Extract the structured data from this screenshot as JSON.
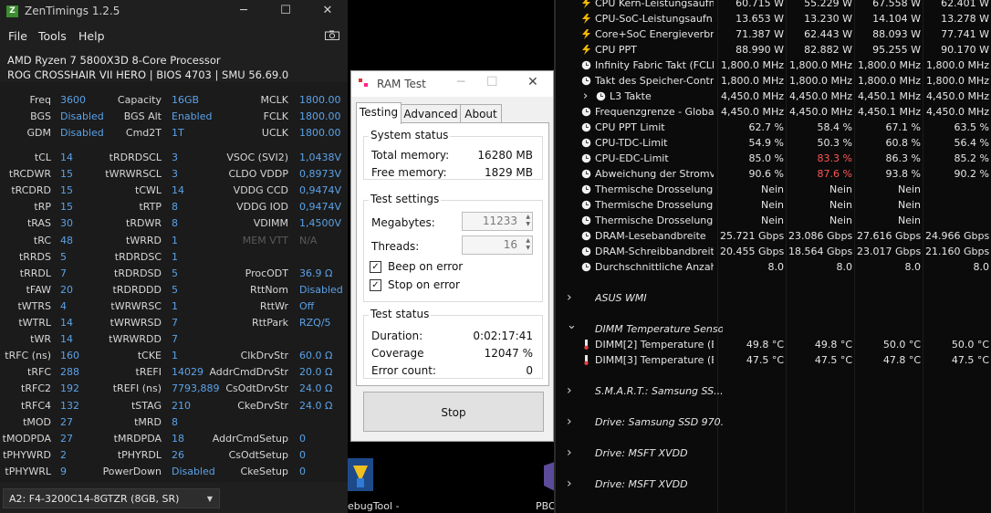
{
  "zentimings": {
    "title": "ZenTimings 1.2.5",
    "logo_letter": "Z",
    "menu": [
      "File",
      "Tools",
      "Help"
    ],
    "cpu": "AMD Ryzen 7 5800X3D 8-Core Processor",
    "board": "ROG CROSSHAIR VII HERO | BIOS 4703 | SMU 56.69.0",
    "top_rows": [
      {
        "a": "Freq",
        "av": "3600",
        "b": "Capacity",
        "bv": "16GB",
        "c": "MCLK",
        "cv": "1800.00"
      },
      {
        "a": "BGS",
        "av": "Disabled",
        "b": "BGS Alt",
        "bv": "Enabled",
        "c": "FCLK",
        "cv": "1800.00"
      },
      {
        "a": "GDM",
        "av": "Disabled",
        "b": "Cmd2T",
        "bv": "1T",
        "c": "UCLK",
        "cv": "1800.00"
      }
    ],
    "timing_rows": [
      {
        "a": "tCL",
        "av": "14",
        "b": "tRDRDSCL",
        "bv": "3",
        "c": "VSOC (SVI2)",
        "cv": "1,0438V"
      },
      {
        "a": "tRCDWR",
        "av": "15",
        "b": "tWRWRSCL",
        "bv": "3",
        "c": "CLDO VDDP",
        "cv": "0,8973V"
      },
      {
        "a": "tRCDRD",
        "av": "15",
        "b": "tCWL",
        "bv": "14",
        "c": "VDDG CCD",
        "cv": "0,9474V"
      },
      {
        "a": "tRP",
        "av": "15",
        "b": "tRTP",
        "bv": "8",
        "c": "VDDG IOD",
        "cv": "0,9474V"
      },
      {
        "a": "tRAS",
        "av": "30",
        "b": "tRDWR",
        "bv": "8",
        "c": "VDIMM",
        "cv": "1,4500V"
      },
      {
        "a": "tRC",
        "av": "48",
        "b": "tWRRD",
        "bv": "1",
        "c": "MEM VTT",
        "cv": "N/A",
        "dim": true
      },
      {
        "a": "tRRDS",
        "av": "5",
        "b": "tRDRDSC",
        "bv": "1",
        "c": "",
        "cv": ""
      },
      {
        "a": "tRRDL",
        "av": "7",
        "b": "tRDRDSD",
        "bv": "5",
        "c": "ProcODT",
        "cv": "36.9 Ω"
      },
      {
        "a": "tFAW",
        "av": "20",
        "b": "tRDRDDD",
        "bv": "5",
        "c": "RttNom",
        "cv": "Disabled"
      },
      {
        "a": "tWTRS",
        "av": "4",
        "b": "tWRWRSC",
        "bv": "1",
        "c": "RttWr",
        "cv": "Off"
      },
      {
        "a": "tWTRL",
        "av": "14",
        "b": "tWRWRSD",
        "bv": "7",
        "c": "RttPark",
        "cv": "RZQ/5"
      },
      {
        "a": "tWR",
        "av": "14",
        "b": "tWRWRDD",
        "bv": "7",
        "c": "",
        "cv": ""
      },
      {
        "a": "tRFC (ns)",
        "av": "160",
        "b": "tCKE",
        "bv": "1",
        "c": "ClkDrvStr",
        "cv": "60.0 Ω"
      },
      {
        "a": "tRFC",
        "av": "288",
        "b": "tREFI",
        "bv": "14029",
        "c": "AddrCmdDrvStr",
        "cv": "20.0 Ω"
      },
      {
        "a": "tRFC2",
        "av": "192",
        "b": "tREFI (ns)",
        "bv": "7793,889",
        "c": "CsOdtDrvStr",
        "cv": "24.0 Ω"
      },
      {
        "a": "tRFC4",
        "av": "132",
        "b": "tSTAG",
        "bv": "210",
        "c": "CkeDrvStr",
        "cv": "24.0 Ω"
      },
      {
        "a": "tMOD",
        "av": "27",
        "b": "tMRD",
        "bv": "8",
        "c": "",
        "cv": ""
      },
      {
        "a": "tMODPDA",
        "av": "27",
        "b": "tMRDPDA",
        "bv": "18",
        "c": "AddrCmdSetup",
        "cv": "0"
      },
      {
        "a": "tPHYWRD",
        "av": "2",
        "b": "tPHYRDL",
        "bv": "26",
        "c": "CsOdtSetup",
        "cv": "0"
      },
      {
        "a": "tPHYWRL",
        "av": "9",
        "b": "PowerDown",
        "bv": "Disabled",
        "c": "CkeSetup",
        "cv": "0"
      }
    ],
    "dimm_select": "A2: F4-3200C14-8GTZR (8GB, SR)"
  },
  "ramtest": {
    "title": "RAM Test",
    "tabs": [
      "Testing",
      "Advanced",
      "About"
    ],
    "system_status": "System status",
    "total_memory_label": "Total memory:",
    "total_memory": "16280 MB",
    "free_memory_label": "Free memory:",
    "free_memory": "1829 MB",
    "test_settings": "Test settings",
    "megabytes_label": "Megabytes:",
    "megabytes": "11233",
    "threads_label": "Threads:",
    "threads": "16",
    "beep_on_error": "Beep on error",
    "stop_on_error": "Stop on error",
    "test_status": "Test status",
    "duration_label": "Duration:",
    "duration": "0:02:17:41",
    "coverage_label": "Coverage",
    "coverage": "12047 %",
    "error_count_label": "Error count:",
    "error_count": "0",
    "stop_button": "Stop"
  },
  "desktop": {
    "icon1_label": "ebugTool -",
    "icon2_label": "PBO"
  },
  "hwinfo": {
    "rows": [
      {
        "kind": "sensor",
        "icon": "bolt",
        "name": "CPU Kern-Leistungsaufn...",
        "v": [
          "60.715 W",
          "55.229 W",
          "67.558 W",
          "62.401 W"
        ]
      },
      {
        "kind": "sensor",
        "icon": "bolt",
        "name": "CPU-SoC-Leistungsaufn...",
        "v": [
          "13.653 W",
          "13.230 W",
          "14.104 W",
          "13.278 W"
        ]
      },
      {
        "kind": "sensor",
        "icon": "bolt",
        "name": "Core+SoC Energieverbr...",
        "v": [
          "71.387 W",
          "62.443 W",
          "88.093 W",
          "77.741 W"
        ]
      },
      {
        "kind": "sensor",
        "icon": "bolt",
        "name": "CPU PPT",
        "v": [
          "88.990 W",
          "82.882 W",
          "95.255 W",
          "90.170 W"
        ]
      },
      {
        "kind": "sensor",
        "icon": "clock",
        "name": "Infinity Fabric Takt (FCLK)",
        "v": [
          "1,800.0 MHz",
          "1,800.0 MHz",
          "1,800.0 MHz",
          "1,800.0 MHz"
        ]
      },
      {
        "kind": "sensor",
        "icon": "clock",
        "name": "Takt des Speicher-Contr...",
        "v": [
          "1,800.0 MHz",
          "1,800.0 MHz",
          "1,800.0 MHz",
          "1,800.0 MHz"
        ]
      },
      {
        "kind": "sensor",
        "icon": "clock",
        "name": "L3 Takte",
        "indent": true,
        "v": [
          "4,450.0 MHz",
          "4,450.0 MHz",
          "4,450.1 MHz",
          "4,450.0 MHz"
        ]
      },
      {
        "kind": "sensor",
        "icon": "clock",
        "name": "Frequenzgrenze - Global",
        "v": [
          "4,450.0 MHz",
          "4,450.0 MHz",
          "4,450.1 MHz",
          "4,450.0 MHz"
        ]
      },
      {
        "kind": "sensor",
        "icon": "clock",
        "name": "CPU PPT Limit",
        "v": [
          "62.7 %",
          "58.4 %",
          "67.1 %",
          "63.5 %"
        ]
      },
      {
        "kind": "sensor",
        "icon": "clock",
        "name": "CPU-TDC-Limit",
        "v": [
          "54.9 %",
          "50.3 %",
          "60.8 %",
          "56.4 %"
        ]
      },
      {
        "kind": "sensor",
        "icon": "clock",
        "name": "CPU-EDC-Limit",
        "v": [
          "85.0 %",
          "83.3 %",
          "86.3 %",
          "85.2 %"
        ],
        "red": [
          1
        ]
      },
      {
        "kind": "sensor",
        "icon": "clock",
        "name": "Abweichung der Stromv...",
        "v": [
          "90.6 %",
          "87.6 %",
          "93.8 %",
          "90.2 %"
        ],
        "red": [
          1
        ]
      },
      {
        "kind": "sensor",
        "icon": "clock",
        "name": "Thermische Drosselung (...",
        "v": [
          "Nein",
          "Nein",
          "Nein",
          ""
        ]
      },
      {
        "kind": "sensor",
        "icon": "clock",
        "name": "Thermische Drosselung (...",
        "v": [
          "Nein",
          "Nein",
          "Nein",
          ""
        ]
      },
      {
        "kind": "sensor",
        "icon": "clock",
        "name": "Thermische Drosselung (...",
        "v": [
          "Nein",
          "Nein",
          "Nein",
          ""
        ]
      },
      {
        "kind": "sensor",
        "icon": "clock",
        "name": "DRAM-Lesebandbreite",
        "v": [
          "25.721 Gbps",
          "23.086 Gbps",
          "27.616 Gbps",
          "24.966 Gbps"
        ]
      },
      {
        "kind": "sensor",
        "icon": "clock",
        "name": "DRAM-Schreibbandbreite",
        "v": [
          "20.455 Gbps",
          "18.564 Gbps",
          "23.017 Gbps",
          "21.160 Gbps"
        ]
      },
      {
        "kind": "sensor",
        "icon": "clock",
        "name": "Durchschnittliche Anzahl ...",
        "v": [
          "8.0",
          "8.0",
          "8.0",
          "8.0"
        ]
      },
      {
        "kind": "blank"
      },
      {
        "kind": "group",
        "name": "ASUS WMI",
        "expanded": false
      },
      {
        "kind": "blank"
      },
      {
        "kind": "group",
        "name": "DIMM Temperature Sensor",
        "expanded": true
      },
      {
        "kind": "sensor",
        "icon": "therm",
        "name": "DIMM[2] Temperature (B...",
        "v": [
          "49.8 °C",
          "49.8 °C",
          "50.0 °C",
          "50.0 °C"
        ]
      },
      {
        "kind": "sensor",
        "icon": "therm",
        "name": "DIMM[3] Temperature (B...",
        "v": [
          "47.5 °C",
          "47.5 °C",
          "47.8 °C",
          "47.5 °C"
        ]
      },
      {
        "kind": "blank"
      },
      {
        "kind": "group",
        "name": "S.M.A.R.T.: Samsung SS...",
        "expanded": false
      },
      {
        "kind": "blank"
      },
      {
        "kind": "group",
        "name": "Drive: Samsung SSD 970...",
        "expanded": false
      },
      {
        "kind": "blank"
      },
      {
        "kind": "group",
        "name": "Drive: MSFT XVDD",
        "expanded": false
      },
      {
        "kind": "blank"
      },
      {
        "kind": "group",
        "name": "Drive: MSFT XVDD",
        "expanded": false
      }
    ]
  }
}
